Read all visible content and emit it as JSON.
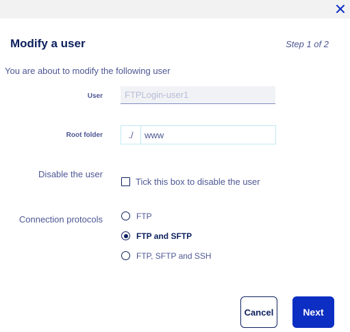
{
  "dialog": {
    "title": "Modify a user",
    "step": "Step 1 of 2",
    "intro": "You are about to modify the following user"
  },
  "form": {
    "user": {
      "label": "User",
      "placeholder": "FTPLogin-user1"
    },
    "root_folder": {
      "label": "Root folder",
      "prefix": "./",
      "value": "www"
    },
    "disable": {
      "label": "Disable the user",
      "checkbox_label": "Tick this box to disable the user",
      "checked": false
    },
    "protocols": {
      "label": "Connection protocols",
      "options": [
        {
          "label": "FTP",
          "selected": false
        },
        {
          "label": "FTP and SFTP",
          "selected": true
        },
        {
          "label": "FTP, SFTP and SSH",
          "selected": false
        }
      ]
    }
  },
  "buttons": {
    "cancel": "Cancel",
    "next": "Next"
  },
  "colors": {
    "primary": "#0d2ec2",
    "text": "#4d5693",
    "dark": "#0b1f5c",
    "topbar": "#f2f2f2"
  },
  "icons": {
    "close": "close-icon"
  }
}
